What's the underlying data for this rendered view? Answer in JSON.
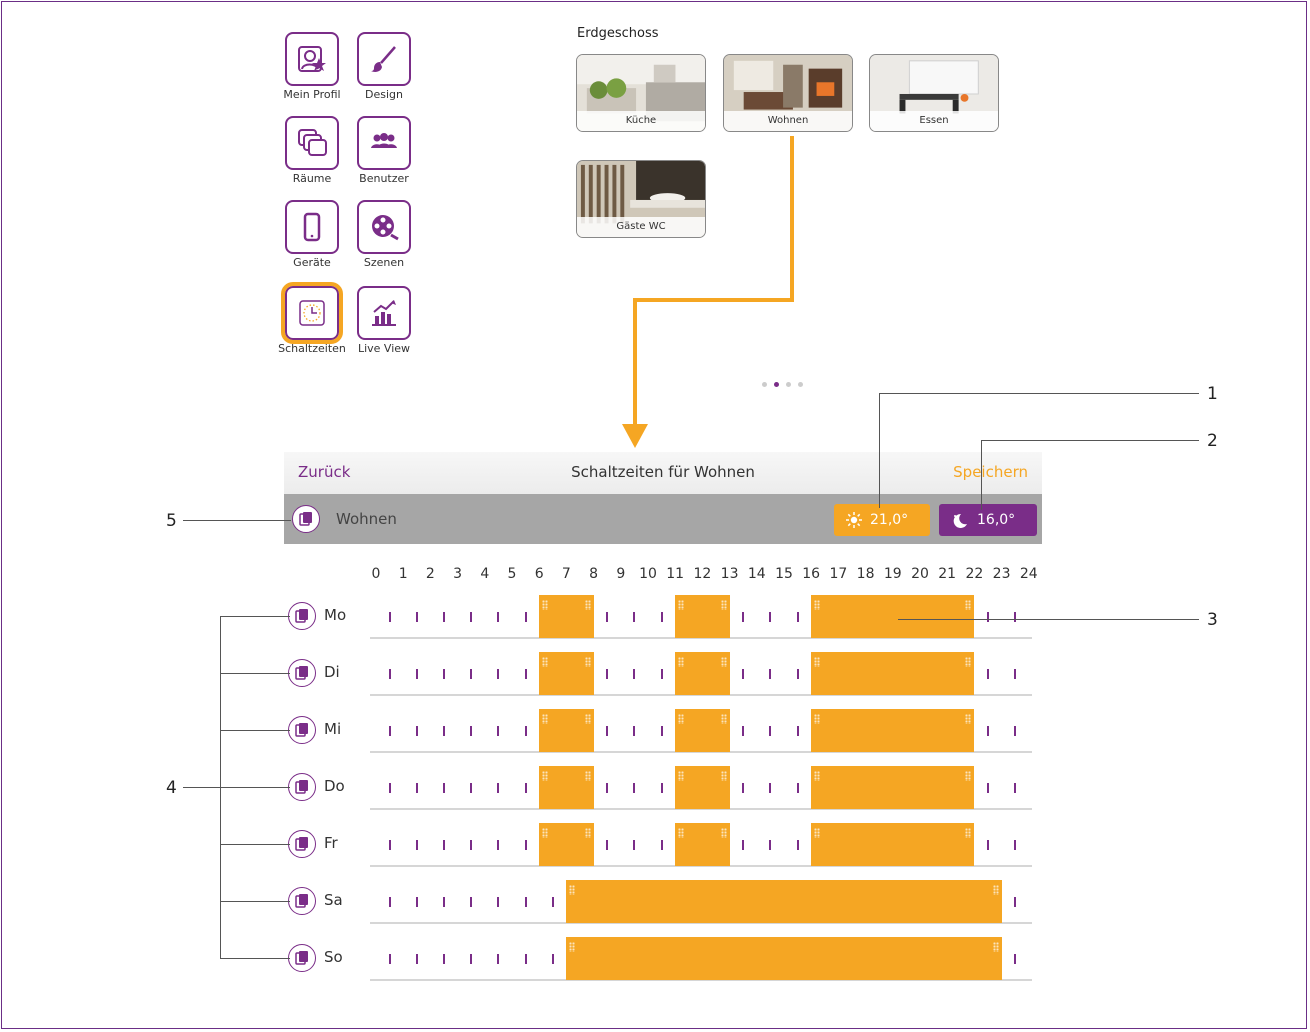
{
  "menu": [
    {
      "label": "Mein Profil",
      "icon": "profile-star-icon"
    },
    {
      "label": "Design",
      "icon": "paintbrush-icon"
    },
    {
      "label": "Räume",
      "icon": "rooms-stack-icon"
    },
    {
      "label": "Benutzer",
      "icon": "users-icon"
    },
    {
      "label": "Geräte",
      "icon": "phone-icon"
    },
    {
      "label": "Szenen",
      "icon": "film-reel-icon"
    },
    {
      "label": "Schaltzeiten",
      "icon": "clock-icon"
    },
    {
      "label": "Live View",
      "icon": "chart-icon"
    }
  ],
  "floor": {
    "label": "Erdgeschoss",
    "rooms": [
      "Küche",
      "Wohnen",
      "Essen",
      "Gäste WC"
    ]
  },
  "schedule": {
    "back_label": "Zurück",
    "title": "Schaltzeiten für Wohnen",
    "save_label": "Speichern",
    "room_name": "Wohnen",
    "day_temp": "21,0°",
    "night_temp": "16,0°",
    "hours": [
      "0",
      "1",
      "2",
      "3",
      "4",
      "5",
      "6",
      "7",
      "8",
      "9",
      "10",
      "11",
      "12",
      "13",
      "14",
      "15",
      "16",
      "17",
      "18",
      "19",
      "20",
      "21",
      "22",
      "23",
      "24"
    ],
    "days": [
      {
        "label": "Mo",
        "blocks": [
          [
            6,
            8
          ],
          [
            11,
            13
          ],
          [
            16,
            22
          ]
        ]
      },
      {
        "label": "Di",
        "blocks": [
          [
            6,
            8
          ],
          [
            11,
            13
          ],
          [
            16,
            22
          ]
        ]
      },
      {
        "label": "Mi",
        "blocks": [
          [
            6,
            8
          ],
          [
            11,
            13
          ],
          [
            16,
            22
          ]
        ]
      },
      {
        "label": "Do",
        "blocks": [
          [
            6,
            8
          ],
          [
            11,
            13
          ],
          [
            16,
            22
          ]
        ]
      },
      {
        "label": "Fr",
        "blocks": [
          [
            6,
            8
          ],
          [
            11,
            13
          ],
          [
            16,
            22
          ]
        ]
      },
      {
        "label": "Sa",
        "blocks": [
          [
            7,
            23
          ]
        ]
      },
      {
        "label": "So",
        "blocks": [
          [
            7,
            23
          ]
        ]
      }
    ]
  },
  "callouts": [
    "1",
    "2",
    "3",
    "4",
    "5"
  ],
  "colors": {
    "accent": "#f5a623",
    "brand": "#7a2d88"
  }
}
